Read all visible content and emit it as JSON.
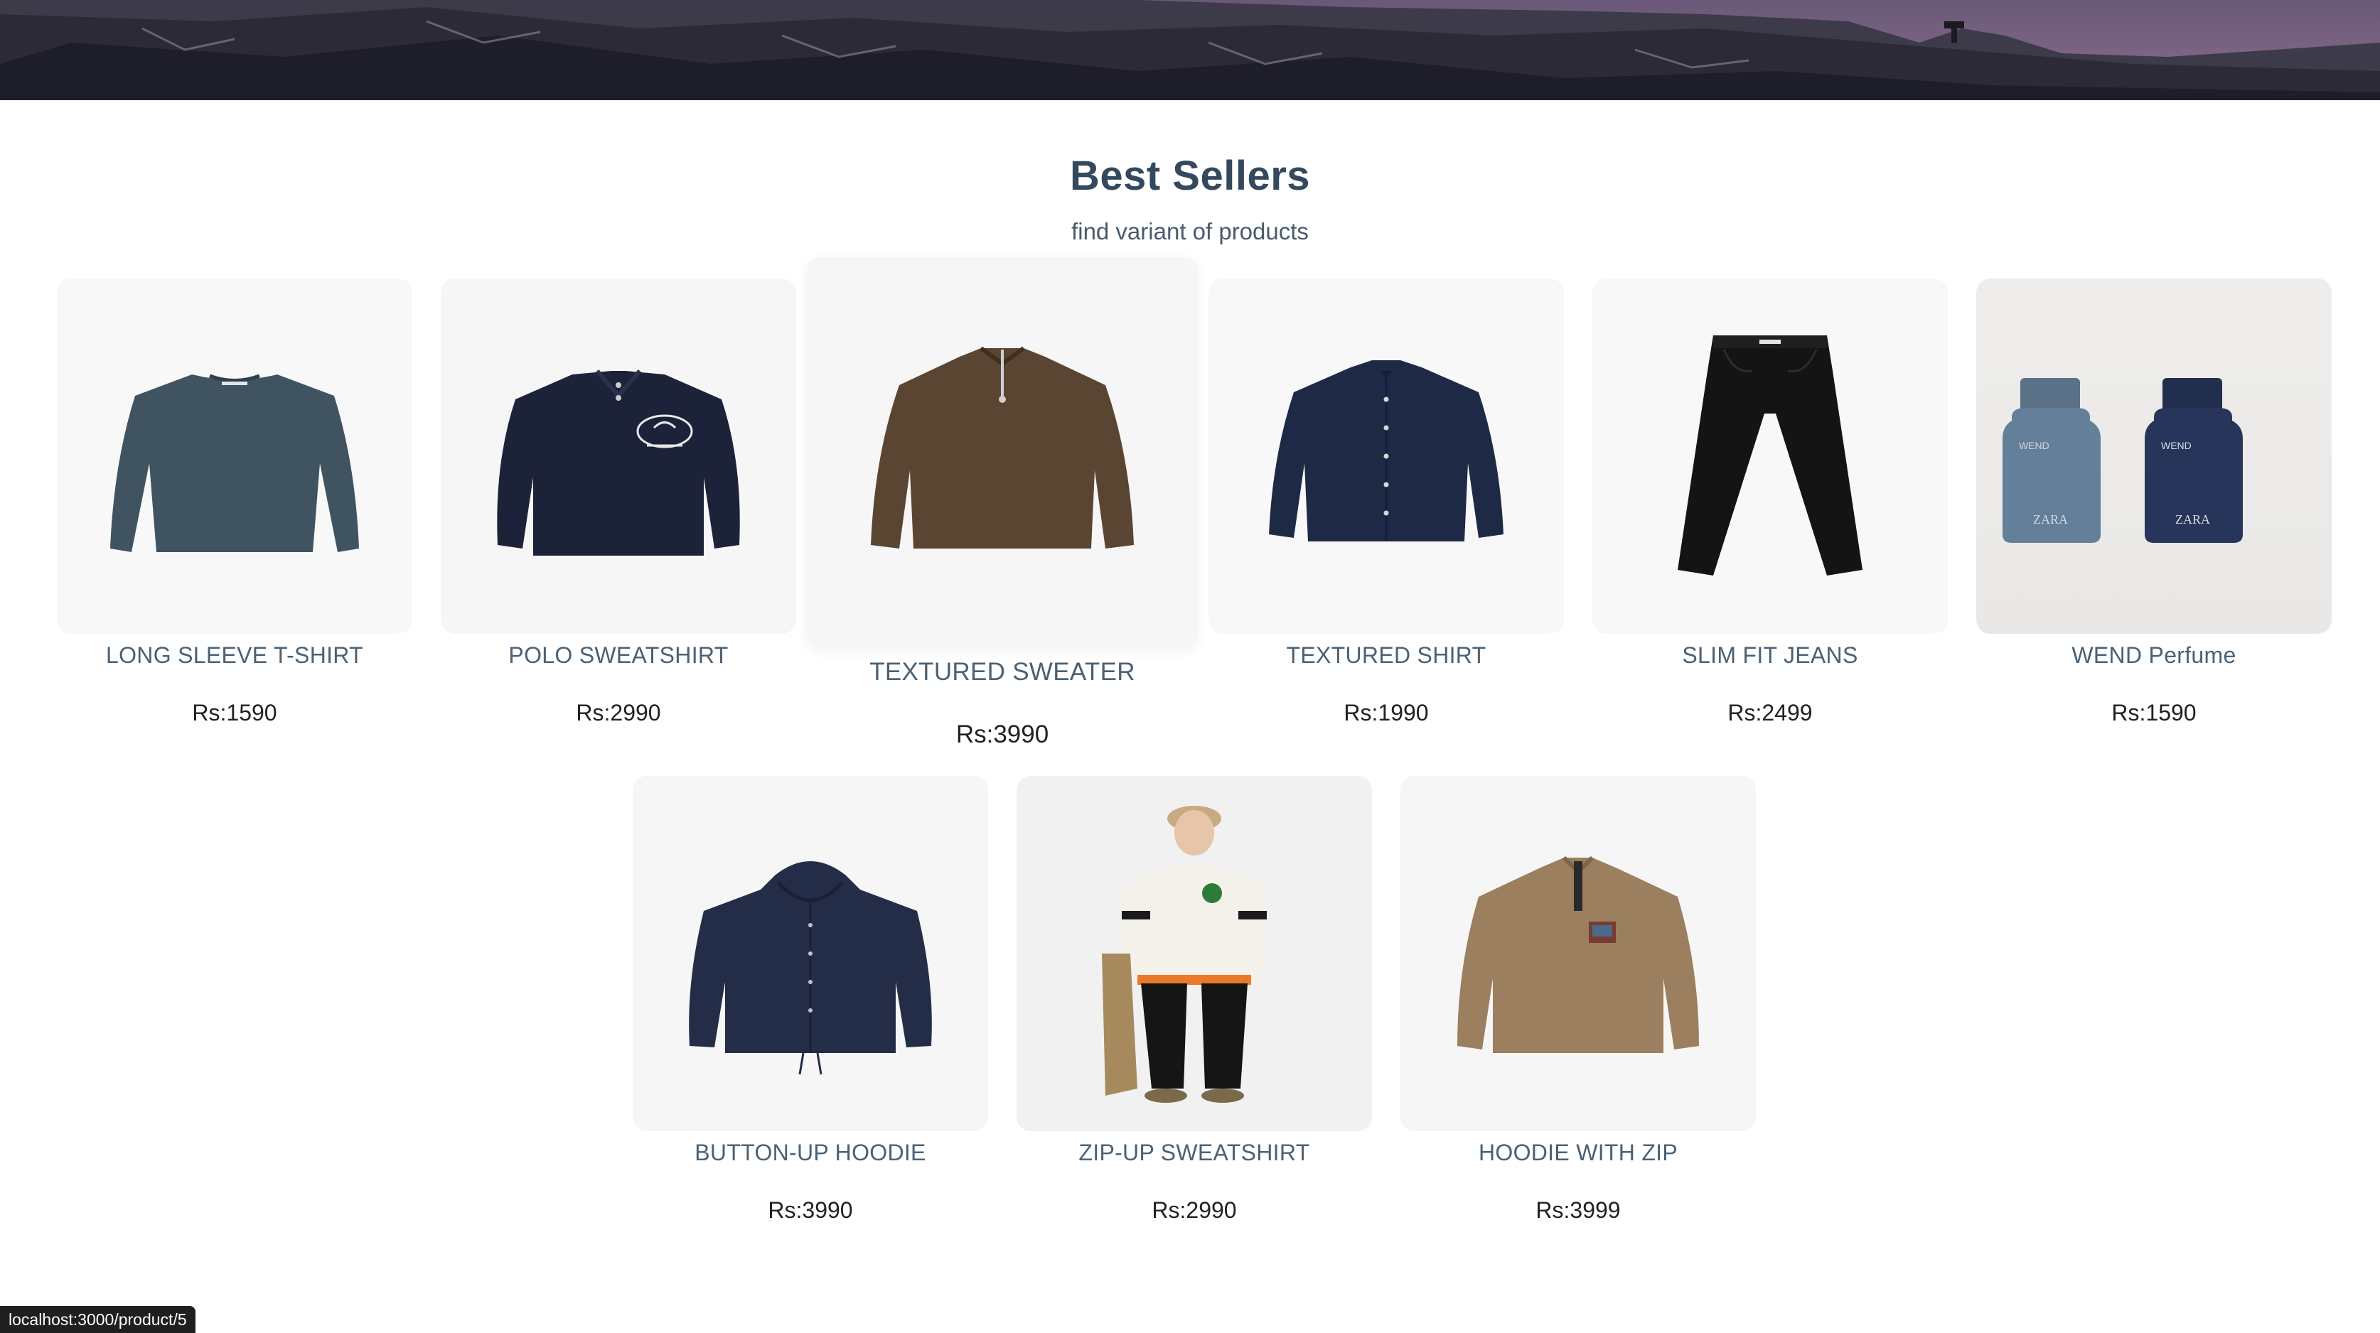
{
  "section": {
    "title": "Best Sellers",
    "subtitle": "find variant of products"
  },
  "products": [
    {
      "name": "LONG SLEEVE T-SHIRT",
      "price": "Rs:1590",
      "image": "tshirt-icon",
      "color": "#3f5360"
    },
    {
      "name": "POLO SWEATSHIRT",
      "price": "Rs:2990",
      "image": "sweatshirt-icon",
      "color": "#1c2238"
    },
    {
      "name": "TEXTURED SWEATER",
      "price": "Rs:3990",
      "image": "zip-sweater-icon",
      "color": "#5a4532"
    },
    {
      "name": "TEXTURED SHIRT",
      "price": "Rs:1990",
      "image": "shirt-icon",
      "color": "#1e2a45"
    },
    {
      "name": "SLIM FIT JEANS",
      "price": "Rs:2499",
      "image": "jeans-icon",
      "color": "#141414"
    },
    {
      "name": "WEND Perfume",
      "price": "Rs:1590",
      "image": "perfume-bottles-icon",
      "color": "#5f7a94"
    },
    {
      "name": "BUTTON-UP HOODIE",
      "price": "Rs:3990",
      "image": "hoodie-icon",
      "color": "#242d48"
    },
    {
      "name": "ZIP-UP SWEATSHIRT",
      "price": "Rs:2990",
      "image": "model-photo-icon",
      "color": "#f4f1ea"
    },
    {
      "name": "HOODIE WITH ZIP",
      "price": "Rs:3999",
      "image": "zip-hoodie-icon",
      "color": "#9c7f5e"
    }
  ],
  "perfume_labels": {
    "brand": "ZARA",
    "line": "WEND"
  },
  "status_bar": {
    "url": "localhost:3000/product/5"
  }
}
